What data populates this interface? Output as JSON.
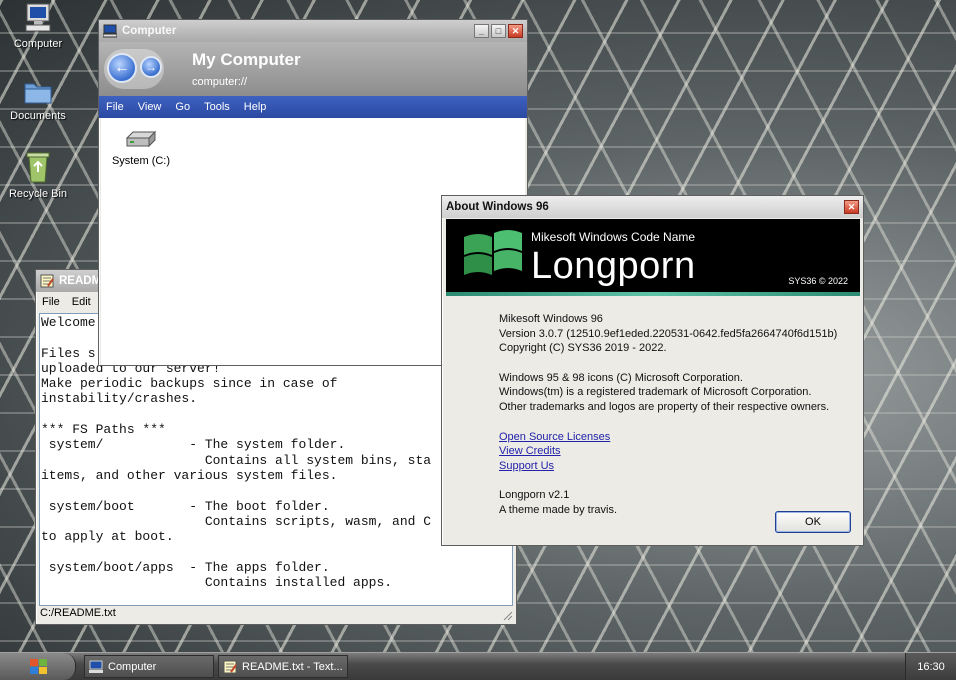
{
  "desktop": {
    "icons": [
      {
        "label": "Computer",
        "icon": "computer-icon"
      },
      {
        "label": "Documents",
        "icon": "folder-icon"
      },
      {
        "label": "Recycle Bin",
        "icon": "recycle-bin-icon"
      }
    ]
  },
  "computer_window": {
    "title": "Computer",
    "header_title": "My Computer",
    "path": "computer://",
    "menu": [
      "File",
      "View",
      "Go",
      "Tools",
      "Help"
    ],
    "back_glyph": "←",
    "forward_glyph": "→",
    "items": [
      {
        "label": "System (C:)",
        "icon": "drive-icon"
      }
    ]
  },
  "readme_window": {
    "title": "README",
    "menu": [
      "File",
      "Edit"
    ],
    "text": "Welcome\n\nFiles s\nuploaded to our server!\nMake periodic backups since in case of\ninstability/crashes.\n\n*** FS Paths ***\n system/           - The system folder.\n                     Contains all system bins, sta\nitems, and other various system files.\n\n system/boot       - The boot folder.\n                     Contains scripts, wasm, and C\nto apply at boot.\n\n system/boot/apps  - The apps folder.\n                     Contains installed apps.",
    "status": "C:/README.txt"
  },
  "about_window": {
    "title": "About Windows 96",
    "banner_subtitle": "Mikesoft Windows Code Name",
    "banner_title": "Longporn",
    "banner_copyright": "SYS36 © 2022",
    "product": "Mikesoft Windows 96",
    "version": "Version 3.0.7 (12510.9ef1eded.220531-0642.fed5fa2664740f6d151b)",
    "copyright": "Copyright (C) SYS36 2019 - 2022.",
    "icons_note": "Windows 95 & 98 icons (C) Microsoft Corporation.",
    "trademark_note": "Windows(tm) is a registered trademark of Microsoft Corporation.",
    "other_note": "Other trademarks and logos are property of their respective owners.",
    "links": [
      "Open Source Licenses",
      "View Credits",
      "Support Us"
    ],
    "theme_name": "Longporn v2.1",
    "theme_credit": "A theme made by travis.",
    "ok_label": "OK"
  },
  "window_controls": {
    "minimize": "_",
    "maximize": "□",
    "close": "✕"
  },
  "taskbar": {
    "tasks": [
      {
        "label": "Computer",
        "icon": "computer-icon"
      },
      {
        "label": "README.txt - Text...",
        "icon": "notepad-icon"
      }
    ],
    "clock": "16:30"
  }
}
